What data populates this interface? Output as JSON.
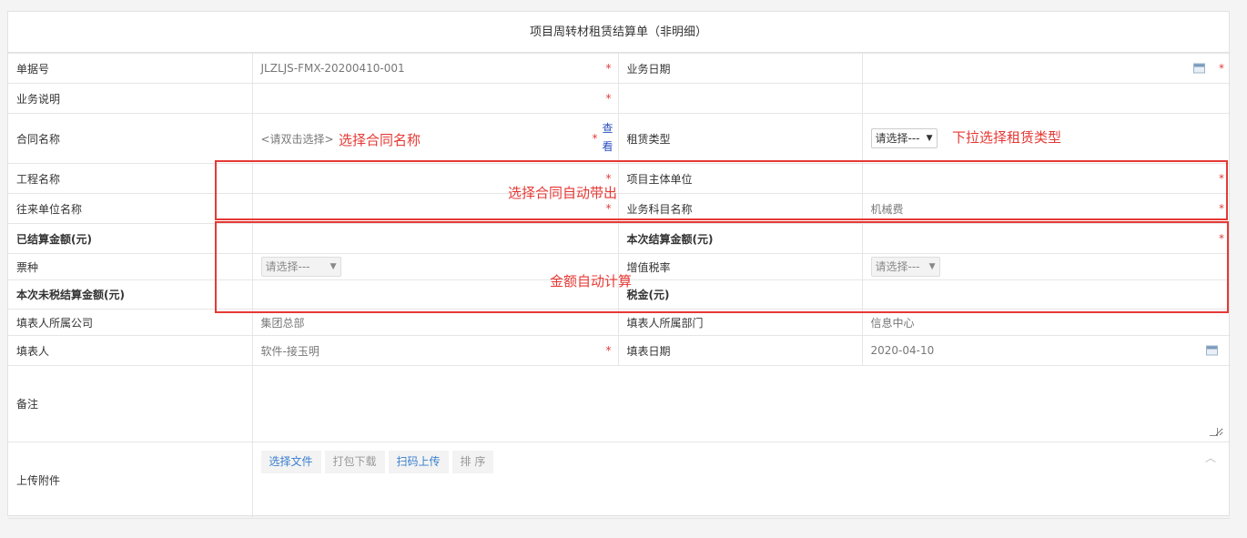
{
  "form": {
    "title": "项目周转材租赁结算单（非明细）",
    "required_mark": "*",
    "rows": {
      "doc_no": {
        "label": "单据号",
        "value": "JLZLJS-FMX-20200410-001"
      },
      "biz_date": {
        "label": "业务日期",
        "value": ""
      },
      "biz_desc": {
        "label": "业务说明",
        "value": ""
      },
      "contract_name": {
        "label": "合同名称",
        "placeholder": "<请双击选择>",
        "view_top": "查",
        "view_bottom": "看"
      },
      "lease_type": {
        "label": "租赁类型",
        "selected": "请选择---"
      },
      "project_name": {
        "label": "工程名称",
        "value": ""
      },
      "project_main_unit": {
        "label": "项目主体单位",
        "value": ""
      },
      "partner_unit": {
        "label": "往来单位名称",
        "value": ""
      },
      "subject_name": {
        "label": "业务科目名称",
        "value": "机械费"
      },
      "settled_amount": {
        "label": "已结算金额(元)",
        "value": ""
      },
      "this_settle_amount": {
        "label": "本次结算金额(元)",
        "value": ""
      },
      "invoice_type": {
        "label": "票种",
        "selected": "请选择---"
      },
      "vat_rate": {
        "label": "增值税率",
        "selected": "请选择---"
      },
      "untaxed_amount": {
        "label": "本次未税结算金额(元)",
        "value": ""
      },
      "tax": {
        "label": "税金(元)",
        "value": ""
      },
      "filler_company": {
        "label": "填表人所属公司",
        "value": "集团总部"
      },
      "filler_dept": {
        "label": "填表人所属部门",
        "value": "信息中心"
      },
      "filler": {
        "label": "填表人",
        "value": "软件-接玉明"
      },
      "fill_date": {
        "label": "填表日期",
        "value": "2020-04-10"
      },
      "remark": {
        "label": "备注",
        "value": ""
      },
      "attachments": {
        "label": "上传附件",
        "buttons": [
          "选择文件",
          "打包下载",
          "扫码上传",
          "排 序"
        ]
      }
    }
  },
  "annotations": {
    "select_contract": "选择合同名称",
    "dropdown_lease_type": "下拉选择租赁类型",
    "auto_bring": "选择合同自动带出",
    "auto_calc": "金额自动计算"
  },
  "colors": {
    "annotation_red": "#e53935",
    "link_blue": "#3a7fcf",
    "border": "#e6e6e6"
  },
  "icons": [
    "calendar-icon",
    "chevron-down-icon",
    "chevron-up-icon",
    "resize-grip-icon"
  ]
}
